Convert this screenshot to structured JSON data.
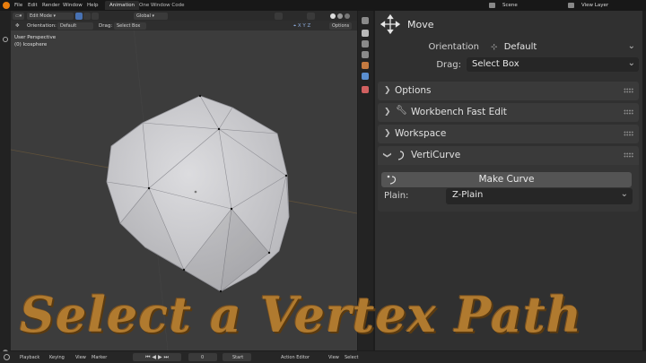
{
  "topbar": {
    "menus": [
      "File",
      "Edit",
      "Render",
      "Window",
      "Help"
    ],
    "tabs": [
      "Animation",
      "One Window Code"
    ],
    "active_tab": "Animation",
    "scene": "Scene",
    "view_layer": "View Layer"
  },
  "viewport_header": {
    "mode": "Edit Mode",
    "transform": "Global",
    "options": "Options"
  },
  "tool_header": {
    "orientation_label": "Orientation:",
    "orientation_value": "Default",
    "drag_label": "Drag:",
    "drag_value": "Select Box"
  },
  "viewport": {
    "perspective": "User Perspective",
    "object": "(0) Icosphere"
  },
  "npanel": {
    "tool_title": "Move",
    "orientation_label": "Orientation",
    "orientation_value": "Default",
    "drag_label": "Drag:",
    "drag_value": "Select Box",
    "panels": [
      {
        "title": "Options"
      },
      {
        "title": "Workbench Fast Edit"
      },
      {
        "title": "Workspace"
      },
      {
        "title": "VertiCurve"
      }
    ],
    "make_curve_label": "Make Curve",
    "plain_label": "Plain:",
    "plain_value": "Z-Plain"
  },
  "bottombar": {
    "playback": "Playback",
    "keying": "Keying",
    "view": "View",
    "marker": "Marker",
    "frame": "0",
    "start": "Start",
    "editor": "Action Editor",
    "view2": "View",
    "select": "Select"
  },
  "caption": "Select a Vertex Path",
  "colors": {
    "accent": "#4872b3",
    "caption": "#b07a2f",
    "viewport_bg": "#3c3c3c",
    "panel_bg": "#303030"
  }
}
